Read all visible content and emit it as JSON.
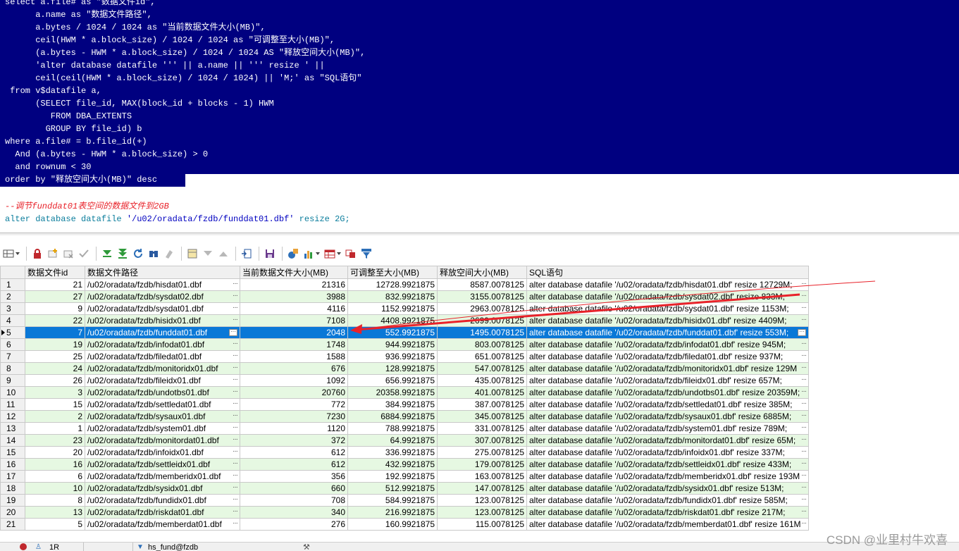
{
  "editor": {
    "selected_lines": [
      "select a.file# as \"数据文件id\",",
      "      a.name as \"数据文件路径\",",
      "      a.bytes / 1024 / 1024 as \"当前数据文件大小(MB)\",",
      "      ceil(HWM * a.block_size) / 1024 / 1024 as \"可调整至大小(MB)\",",
      "      (a.bytes - HWM * a.block_size) / 1024 / 1024 AS \"释放空间大小(MB)\",",
      "      'alter database datafile ''' || a.name || ''' resize ' ||",
      "      ceil(ceil(HWM * a.block_size) / 1024 / 1024) || 'M;' as \"SQL语句\"",
      " from v$datafile a,",
      "      (SELECT file_id, MAX(block_id + blocks - 1) HWM",
      "         FROM DBA_EXTENTS",
      "        GROUP BY file_id) b",
      "where a.file# = b.file_id(+)",
      "  And (a.bytes - HWM * a.block_size) > 0",
      "  and rownum < 30",
      "order by \"释放空间大小(MB)\" desc"
    ],
    "comment": "--调节funddat01表空间的数据文件到2GB",
    "alter_kw": "alter database datafile ",
    "alter_str": "'/u02/oradata/fzdb/funddat01.dbf'",
    "alter_tail": " resize 2G;"
  },
  "grid": {
    "columns": [
      "数据文件id",
      "数据文件路径",
      "当前数据文件大小(MB)",
      "可调整至大小(MB)",
      "释放空间大小(MB)",
      "SQL语句"
    ],
    "selected_row": 5,
    "rows": [
      {
        "n": "1",
        "id": "21",
        "path": "/u02/oradata/fzdb/hisdat01.dbf",
        "cur": "21316",
        "adj": "12728.9921875",
        "rel": "8587.0078125",
        "sql": "alter database datafile '/u02/oradata/fzdb/hisdat01.dbf' resize 12729M;"
      },
      {
        "n": "2",
        "id": "27",
        "path": "/u02/oradata/fzdb/sysdat02.dbf",
        "cur": "3988",
        "adj": "832.9921875",
        "rel": "3155.0078125",
        "sql": "alter database datafile '/u02/oradata/fzdb/sysdat02.dbf' resize 833M;"
      },
      {
        "n": "3",
        "id": "9",
        "path": "/u02/oradata/fzdb/sysdat01.dbf",
        "cur": "4116",
        "adj": "1152.9921875",
        "rel": "2963.0078125",
        "sql": "alter database datafile '/u02/oradata/fzdb/sysdat01.dbf' resize 1153M;"
      },
      {
        "n": "4",
        "id": "22",
        "path": "/u02/oradata/fzdb/hisidx01.dbf",
        "cur": "7108",
        "adj": "4408.9921875",
        "rel": "2699.0078125",
        "sql": "alter database datafile '/u02/oradata/fzdb/hisidx01.dbf' resize 4409M;"
      },
      {
        "n": "5",
        "id": "7",
        "path": "/u02/oradata/fzdb/funddat01.dbf",
        "cur": "2048",
        "adj": "552.9921875",
        "rel": "1495.0078125",
        "sql": "alter database datafile '/u02/oradata/fzdb/funddat01.dbf' resize 553M;"
      },
      {
        "n": "6",
        "id": "19",
        "path": "/u02/oradata/fzdb/infodat01.dbf",
        "cur": "1748",
        "adj": "944.9921875",
        "rel": "803.0078125",
        "sql": "alter database datafile '/u02/oradata/fzdb/infodat01.dbf' resize 945M;"
      },
      {
        "n": "7",
        "id": "25",
        "path": "/u02/oradata/fzdb/filedat01.dbf",
        "cur": "1588",
        "adj": "936.9921875",
        "rel": "651.0078125",
        "sql": "alter database datafile '/u02/oradata/fzdb/filedat01.dbf' resize 937M;"
      },
      {
        "n": "8",
        "id": "24",
        "path": "/u02/oradata/fzdb/monitoridx01.dbf",
        "cur": "676",
        "adj": "128.9921875",
        "rel": "547.0078125",
        "sql": "alter database datafile '/u02/oradata/fzdb/monitoridx01.dbf' resize 129M"
      },
      {
        "n": "9",
        "id": "26",
        "path": "/u02/oradata/fzdb/fileidx01.dbf",
        "cur": "1092",
        "adj": "656.9921875",
        "rel": "435.0078125",
        "sql": "alter database datafile '/u02/oradata/fzdb/fileidx01.dbf' resize 657M;"
      },
      {
        "n": "10",
        "id": "3",
        "path": "/u02/oradata/fzdb/undotbs01.dbf",
        "cur": "20760",
        "adj": "20358.9921875",
        "rel": "401.0078125",
        "sql": "alter database datafile '/u02/oradata/fzdb/undotbs01.dbf' resize 20359M;"
      },
      {
        "n": "11",
        "id": "15",
        "path": "/u02/oradata/fzdb/settledat01.dbf",
        "cur": "772",
        "adj": "384.9921875",
        "rel": "387.0078125",
        "sql": "alter database datafile '/u02/oradata/fzdb/settledat01.dbf' resize 385M;"
      },
      {
        "n": "12",
        "id": "2",
        "path": "/u02/oradata/fzdb/sysaux01.dbf",
        "cur": "7230",
        "adj": "6884.9921875",
        "rel": "345.0078125",
        "sql": "alter database datafile '/u02/oradata/fzdb/sysaux01.dbf' resize 6885M;"
      },
      {
        "n": "13",
        "id": "1",
        "path": "/u02/oradata/fzdb/system01.dbf",
        "cur": "1120",
        "adj": "788.9921875",
        "rel": "331.0078125",
        "sql": "alter database datafile '/u02/oradata/fzdb/system01.dbf' resize 789M;"
      },
      {
        "n": "14",
        "id": "23",
        "path": "/u02/oradata/fzdb/monitordat01.dbf",
        "cur": "372",
        "adj": "64.9921875",
        "rel": "307.0078125",
        "sql": "alter database datafile '/u02/oradata/fzdb/monitordat01.dbf' resize 65M;"
      },
      {
        "n": "15",
        "id": "20",
        "path": "/u02/oradata/fzdb/infoidx01.dbf",
        "cur": "612",
        "adj": "336.9921875",
        "rel": "275.0078125",
        "sql": "alter database datafile '/u02/oradata/fzdb/infoidx01.dbf' resize 337M;"
      },
      {
        "n": "16",
        "id": "16",
        "path": "/u02/oradata/fzdb/settleidx01.dbf",
        "cur": "612",
        "adj": "432.9921875",
        "rel": "179.0078125",
        "sql": "alter database datafile '/u02/oradata/fzdb/settleidx01.dbf' resize 433M;"
      },
      {
        "n": "17",
        "id": "6",
        "path": "/u02/oradata/fzdb/memberidx01.dbf",
        "cur": "356",
        "adj": "192.9921875",
        "rel": "163.0078125",
        "sql": "alter database datafile '/u02/oradata/fzdb/memberidx01.dbf' resize 193M"
      },
      {
        "n": "18",
        "id": "10",
        "path": "/u02/oradata/fzdb/sysidx01.dbf",
        "cur": "660",
        "adj": "512.9921875",
        "rel": "147.0078125",
        "sql": "alter database datafile '/u02/oradata/fzdb/sysidx01.dbf' resize 513M;"
      },
      {
        "n": "19",
        "id": "8",
        "path": "/u02/oradata/fzdb/fundidx01.dbf",
        "cur": "708",
        "adj": "584.9921875",
        "rel": "123.0078125",
        "sql": "alter database datafile '/u02/oradata/fzdb/fundidx01.dbf' resize 585M;"
      },
      {
        "n": "20",
        "id": "13",
        "path": "/u02/oradata/fzdb/riskdat01.dbf",
        "cur": "340",
        "adj": "216.9921875",
        "rel": "123.0078125",
        "sql": "alter database datafile '/u02/oradata/fzdb/riskdat01.dbf' resize 217M;"
      },
      {
        "n": "21",
        "id": "5",
        "path": "/u02/oradata/fzdb/memberdat01.dbf",
        "cur": "276",
        "adj": "160.9921875",
        "rel": "115.0078125",
        "sql": "alter database datafile '/u02/oradata/fzdb/memberdat01.dbf' resize 161M"
      }
    ]
  },
  "toolbar": {
    "icons": [
      "grid-options-icon",
      "lock-icon",
      "add-record-icon",
      "delete-record-icon",
      "post-changes-icon",
      "fetch-next-icon",
      "fetch-last-icon",
      "refresh-icon",
      "find-icon",
      "clear-icon",
      "query-by-example-icon",
      "filter-icon",
      "sort-icon",
      "single-record-view-icon",
      "save-icon",
      "export-icon",
      "chart-icon",
      "grid-layout-icon",
      "print-icon",
      "column-filter-icon"
    ]
  },
  "status": {
    "rows_text": "1R",
    "connection": "hs_fund@fzdb"
  },
  "watermark": "CSDN @业里村牛欢喜",
  "colors": {
    "selection_bg": "#000080",
    "selected_row_bg": "#0a78d7",
    "alt_row_bg": "#e6f8e2",
    "arrow": "#e8222a"
  }
}
